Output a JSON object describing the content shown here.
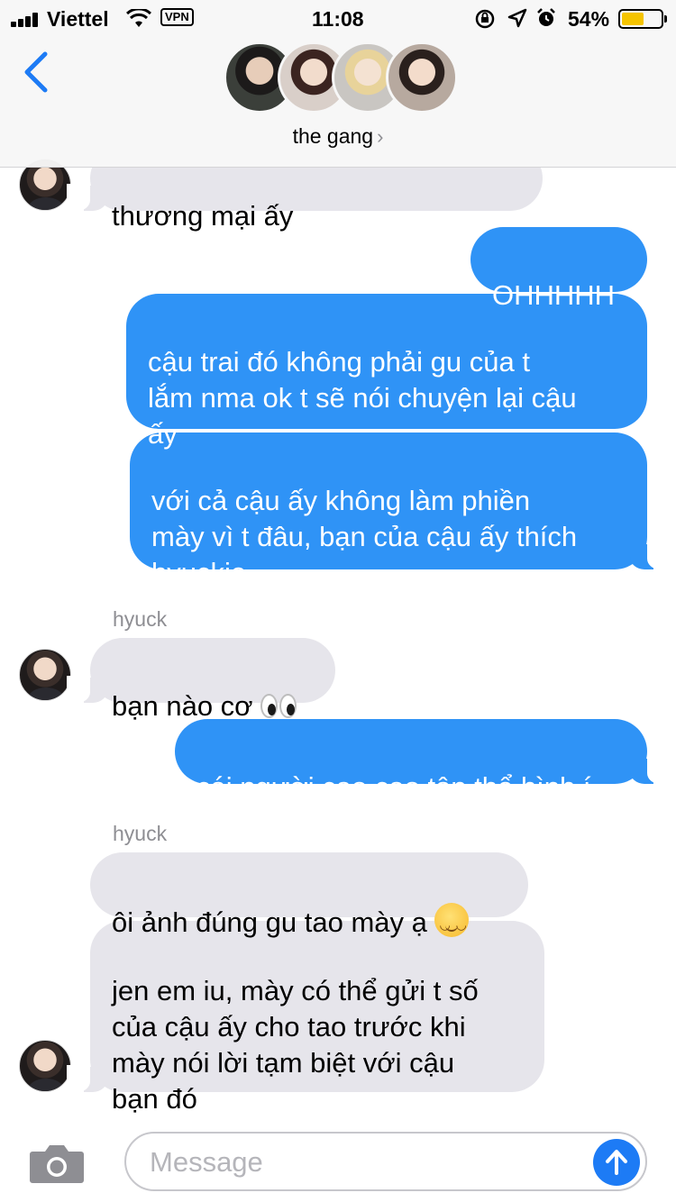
{
  "status_bar": {
    "carrier": "Viettel",
    "vpn": "VPN",
    "time": "11:08",
    "battery_percent": "54%",
    "battery_level": 0.54,
    "icons": [
      "cellular-signal-icon",
      "wifi-icon",
      "orientation-lock-icon",
      "location-arrow-icon",
      "alarm-icon",
      "battery-icon"
    ]
  },
  "header": {
    "back_icon": "chevron-left-icon",
    "group_name": "the gang",
    "group_chevron": "›",
    "accent_color": "#1d7bf5"
  },
  "messages": [
    {
      "direction": "incoming",
      "text": "thương mại ấy"
    },
    {
      "direction": "outgoing",
      "text": "OHHHHH"
    },
    {
      "direction": "outgoing",
      "text": "cậu trai đó không phải gu của t\nlắm nma ok t sẽ nói chuyện lại cậu\nấy"
    },
    {
      "direction": "outgoing",
      "text": "với cả cậu ấy không làm phiền\nmày vì t đâu, bạn của cậu ấy thích\nhyuckie"
    },
    {
      "direction": "incoming",
      "sender": "hyuck",
      "text": "bạn nào cơ ",
      "emoji": "eyes-emoji"
    },
    {
      "direction": "outgoing",
      "text": "cái người cao cao tập thể hình í"
    },
    {
      "direction": "incoming",
      "sender": "hyuck",
      "text": "ôi ảnh đúng gu tao mày ạ ",
      "emoji": "relieved-face-emoji"
    },
    {
      "direction": "incoming",
      "text": "jen em iu, mày có thể gửi t số\ncủa cậu ấy cho tao trước khi\nmày nói lời tạm biệt với cậu\nbạn đó"
    }
  ],
  "input_bar": {
    "placeholder": "Message",
    "camera_icon": "camera-icon",
    "send_icon": "send-arrow-icon",
    "outgoing_bubble_color": "#2f93f6",
    "incoming_bubble_color": "#e6e5eb"
  }
}
